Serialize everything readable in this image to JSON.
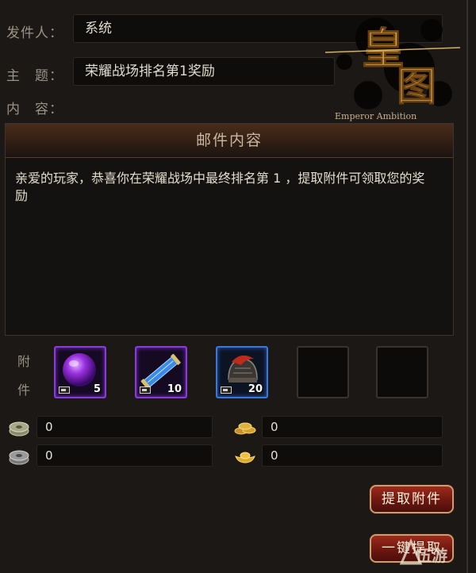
{
  "mail": {
    "sender_label": "发件人：",
    "sender_value": "系统",
    "subject_label": "主　题：",
    "subject_value": "荣耀战场排名第1奖励",
    "content_label": "内　容："
  },
  "content_panel": {
    "title": "邮件内容",
    "body": "亲爱的玩家，恭喜你在荣耀战场中最终排名第 1 ，提取附件可领取您的奖励"
  },
  "logo": {
    "main": "皇图",
    "subtitle": "Emperor Ambition"
  },
  "attachments": {
    "label_top": "附",
    "label_bottom": "件",
    "slots": [
      {
        "item": "purple-orb",
        "quality": "purple",
        "count": "5"
      },
      {
        "item": "blue-scroll",
        "quality": "purple",
        "count": "10"
      },
      {
        "item": "helmet",
        "quality": "blue",
        "count": "20"
      },
      {
        "item": "",
        "quality": "empty",
        "count": ""
      },
      {
        "item": "",
        "quality": "empty",
        "count": ""
      }
    ]
  },
  "currencies": {
    "silver_coin": "0",
    "gold_coin": "0",
    "copper_coin": "0",
    "gold_ingot": "0"
  },
  "buttons": {
    "extract": "提取附件",
    "extract_all": "一键提取"
  },
  "watermark": "伍游",
  "colors": {
    "accent_gold": "#c8a070",
    "button_red": "#8a2216",
    "purple_quality": "#8a3cd8",
    "blue_quality": "#3a78d8"
  }
}
